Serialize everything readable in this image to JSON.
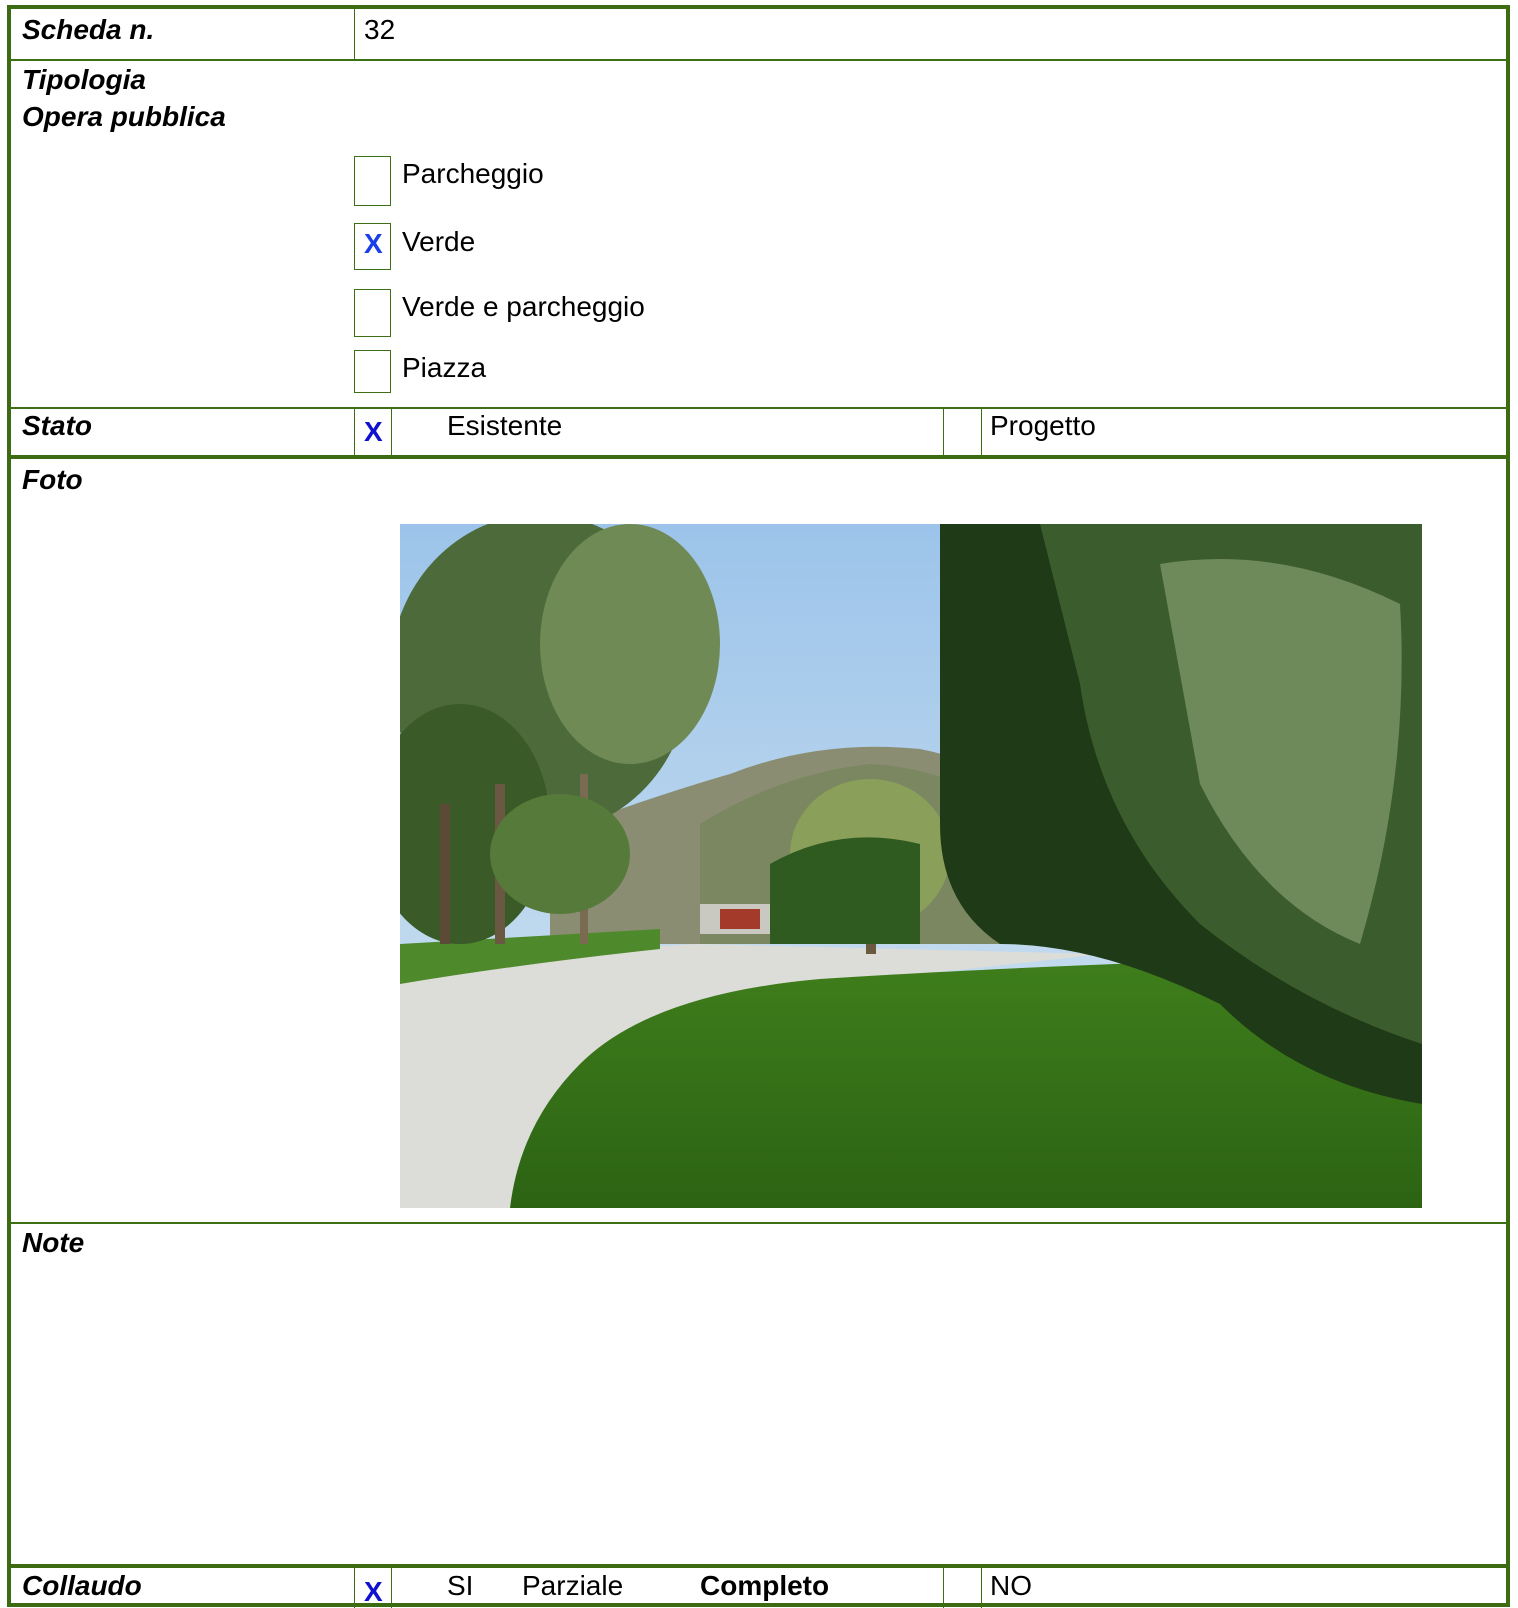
{
  "scheda": {
    "label": "Scheda n.",
    "value": "32"
  },
  "tipologia": {
    "label_line1": "Tipologia",
    "label_line2": "Opera pubblica",
    "options": [
      {
        "label": "Parcheggio",
        "checked": false,
        "mark": ""
      },
      {
        "label": "Verde",
        "checked": true,
        "mark": "X"
      },
      {
        "label": "Verde e parcheggio",
        "checked": false,
        "mark": ""
      },
      {
        "label": "Piazza",
        "checked": false,
        "mark": ""
      }
    ]
  },
  "stato": {
    "label": "Stato",
    "mark": "X",
    "option_existing": "Esistente",
    "option_project": "Progetto"
  },
  "foto": {
    "label": "Foto"
  },
  "note": {
    "label": "Note"
  },
  "collaudo": {
    "label": "Collaudo",
    "mark": "X",
    "option_si": "SI",
    "option_parziale": "Parziale",
    "option_completo": "Completo",
    "option_no": "NO"
  },
  "colors": {
    "border": "#3d6b12",
    "check_mark": "#1a3fe8"
  }
}
